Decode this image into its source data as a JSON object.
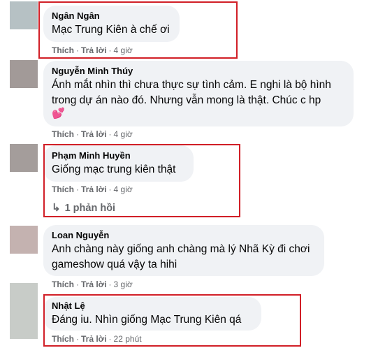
{
  "comments": [
    {
      "author": "Ngân Ngân",
      "text": "Mạc Trung Kiên à chế ơi",
      "like": "Thích",
      "reply": "Trả lời",
      "dot": "·",
      "time": "4 giờ",
      "avatar_color": "#b6c1c4"
    },
    {
      "author": "Nguyễn Minh Thúy",
      "text_line1": "Ánh mắt nhìn thì chưa thực sự tình cảm. E nghi là bộ hình",
      "text_line2": "trong dự án nào đó. Nhưng vẫn mong là thật. Chúc c hp",
      "emoji": "💕",
      "like": "Thích",
      "reply": "Trả lời",
      "dot": "·",
      "time": "4 giờ",
      "avatar_color": "#a29a98"
    },
    {
      "author": "Phạm Minh Huyền",
      "text": "Giống mạc trung kiên thật",
      "like": "Thích",
      "reply": "Trả lời",
      "dot": "·",
      "time": "4 giờ",
      "replies_label": "1 phản hồi",
      "avatar_color": "#a49d9b"
    },
    {
      "author": "Loan Nguyễn",
      "text_line1": "Anh chàng này giống anh chàng mà lý Nhã Kỳ đi chơi",
      "text_line2": "gameshow quá vậy ta hihi",
      "like": "Thích",
      "reply": "Trả lời",
      "dot": "·",
      "time": "3 giờ",
      "avatar_color": "#c4b2b0"
    },
    {
      "author": "Nhật Lệ",
      "text": "Đáng iu. Nhìn giống Mạc Trung Kiên qá",
      "like": "Thích",
      "reply": "Trả lời",
      "dot": "·",
      "time": "22 phút",
      "avatar_color": "#c8ccc8"
    }
  ],
  "colors": {
    "highlight": "#d11f27",
    "bubble": "#f0f2f5",
    "meta": "#65676b"
  }
}
